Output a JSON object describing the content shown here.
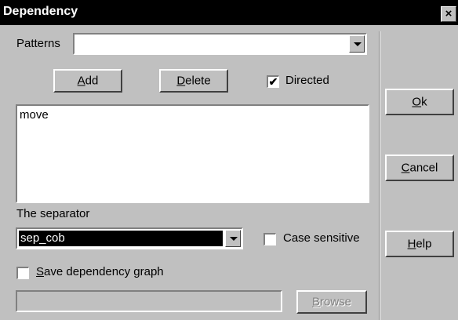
{
  "window": {
    "title": "Dependency",
    "close_glyph": "×"
  },
  "patterns": {
    "label": "Patterns",
    "value": ""
  },
  "buttons": {
    "add": {
      "mnemonic": "A",
      "rest": "dd"
    },
    "delete": {
      "mnemonic": "D",
      "rest": "elete"
    },
    "ok": {
      "mnemonic": "O",
      "rest": "k"
    },
    "cancel": {
      "mnemonic": "C",
      "rest": "ancel"
    },
    "help": {
      "mnemonic": "H",
      "rest": "elp"
    },
    "browse": {
      "mnemonic": "B",
      "rest": "rowse"
    }
  },
  "directed": {
    "label": "Directed",
    "checked": true,
    "mark": "✔"
  },
  "list": {
    "items": [
      "move"
    ]
  },
  "separator": {
    "label": "The separator",
    "value": "sep_cob"
  },
  "case_sensitive": {
    "label": "Case sensitive",
    "checked": false
  },
  "save_graph": {
    "mnemonic": "S",
    "rest": "ave dependency graph",
    "checked": false
  },
  "path_field": {
    "value": ""
  }
}
